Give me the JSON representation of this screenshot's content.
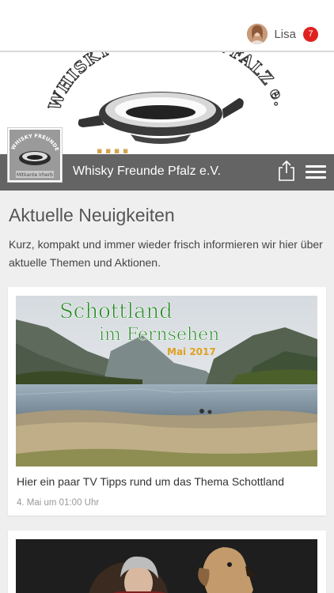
{
  "user": {
    "name": "Lisa",
    "notifications": "7"
  },
  "banner": {
    "logo_text": "WHISKY FREUNDE PFALZ e.V."
  },
  "club_logo": {
    "text_top": "WHISKY FREUNDE PFALZ",
    "text_bottom": "Mitkante Irherb"
  },
  "header": {
    "title": "Whisky Freunde Pfalz e.V."
  },
  "main": {
    "section_title": "Aktuelle Neuigkeiten",
    "intro": "Kurz, kompakt und immer wieder frisch informieren wir hier über aktuelle Themen und Aktionen."
  },
  "posts": [
    {
      "image_title_line1": "Schottland",
      "image_title_line2": "im Fernsehen",
      "image_subtitle": "Mai 2017",
      "text": "Hier ein paar TV Tipps rund um das Thema Schottland",
      "date": "4. Mai um 01:00 Uhr"
    },
    {
      "text": "",
      "date": ""
    }
  ],
  "colors": {
    "titlebar": "#646464",
    "badge": "#e02020",
    "title_green": "#2c8a2c",
    "subtitle_gold": "#e0a020"
  }
}
